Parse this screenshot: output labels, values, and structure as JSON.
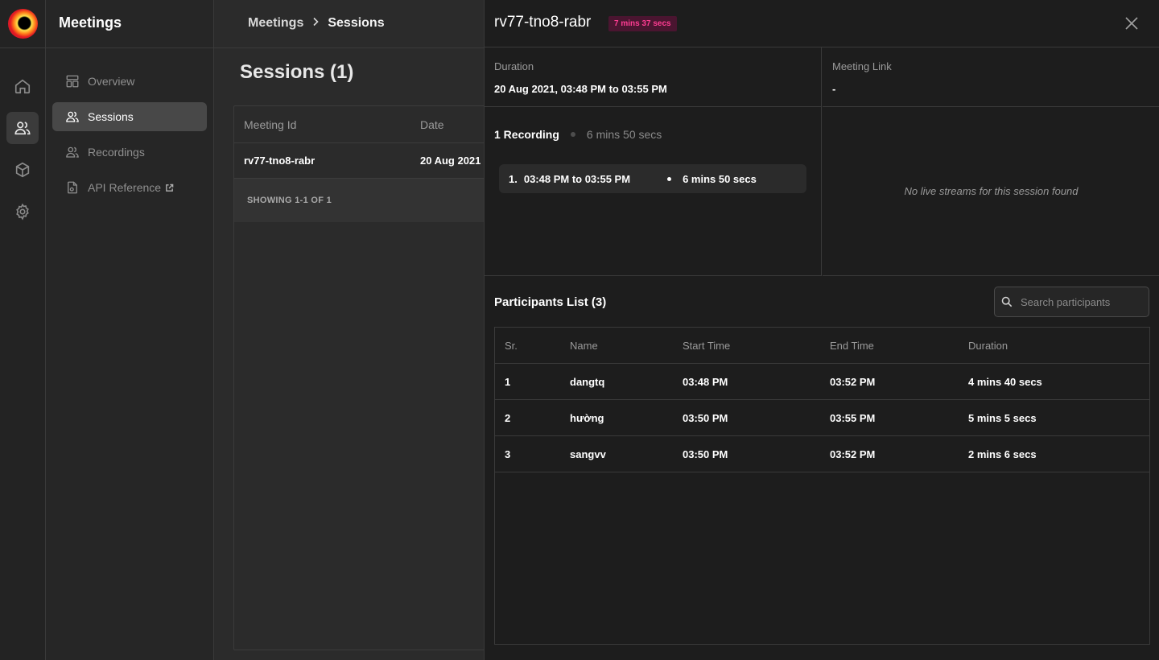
{
  "app": {
    "section_title": "Meetings"
  },
  "sidebar": {
    "items": [
      {
        "label": "Overview",
        "icon": "layout-icon"
      },
      {
        "label": "Sessions",
        "icon": "users-icon",
        "active": true
      },
      {
        "label": "Recordings",
        "icon": "users-icon"
      },
      {
        "label": "API Reference",
        "icon": "document-icon",
        "external": true
      }
    ]
  },
  "rail": {
    "items": [
      "home-icon",
      "users-icon",
      "box-icon",
      "gear-icon"
    ],
    "active": "users-icon"
  },
  "breadcrumb": {
    "parent": "Meetings",
    "separator": ">",
    "current": "Sessions"
  },
  "sessions": {
    "title": "Sessions (1)",
    "columns": [
      "Meeting Id",
      "Date"
    ],
    "rows": [
      {
        "meeting_id": "rv77-tno8-rabr",
        "date": "20 Aug 2021"
      }
    ],
    "footer": "SHOWING 1-1 OF 1"
  },
  "drawer": {
    "title": "rv77-tno8-rabr",
    "badge": "7 mins 37 secs",
    "duration_label": "Duration",
    "duration_value": "20 Aug 2021, 03:48 PM to 03:55 PM",
    "link_label": "Meeting Link",
    "link_value": "-",
    "recording": {
      "count_label": "1 Recording",
      "total_duration": "6 mins 50 secs",
      "items": [
        {
          "index": "1.",
          "range": "03:48 PM to 03:55 PM",
          "duration": "6 mins 50 secs"
        }
      ]
    },
    "live_streams_empty": "No live streams for this session found",
    "participants": {
      "title": "Participants List (3)",
      "search_placeholder": "Search participants",
      "columns": [
        "Sr.",
        "Name",
        "Start Time",
        "End Time",
        "Duration"
      ],
      "rows": [
        {
          "sr": "1",
          "name": "dangtq",
          "start": "03:48 PM",
          "end": "03:52 PM",
          "duration": "4 mins 40 secs"
        },
        {
          "sr": "2",
          "name": "hường",
          "start": "03:50 PM",
          "end": "03:55 PM",
          "duration": "5 mins 5 secs"
        },
        {
          "sr": "3",
          "name": "sangvv",
          "start": "03:50 PM",
          "end": "03:52 PM",
          "duration": "2 mins 6 secs"
        }
      ]
    }
  },
  "colors": {
    "badge_bg": "#4a1530",
    "badge_text": "#ff3d93",
    "logo_red": "#e21b23",
    "logo_yellow": "#ffe14a"
  }
}
